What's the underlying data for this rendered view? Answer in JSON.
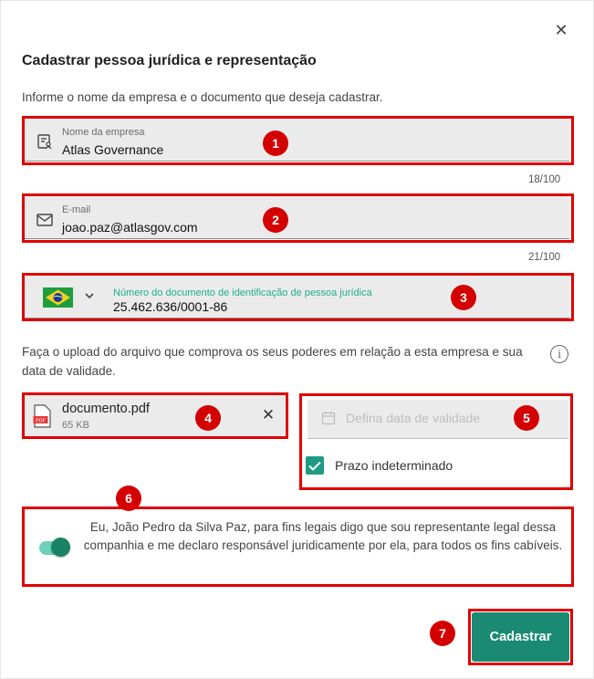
{
  "dialog": {
    "title": "Cadastrar pessoa jurídica e representação",
    "intro": "Informe o nome da empresa e o documento que deseja cadastrar.",
    "close_icon": "close-icon"
  },
  "company_field": {
    "label": "Nome da empresa",
    "value": "Atlas Governance",
    "counter": "18/100",
    "icon": "company-id-icon"
  },
  "email_field": {
    "label": "E-mail",
    "value": "joao.paz@atlasgov.com",
    "counter": "21/100",
    "icon": "envelope-icon"
  },
  "document_field": {
    "label": "Número do documento de identificação de pessoa jurídica",
    "value": "25.462.636/0001-86",
    "country_icon": "brazil-flag-icon"
  },
  "upload": {
    "text": "Faça o upload do arquivo que comprova os seus poderes em relação a esta empresa e sua data de validade.",
    "file_name": "documento.pdf",
    "file_size": "65 KB",
    "file_badge": "PDF"
  },
  "validity": {
    "placeholder": "Defina data de validade",
    "checkbox_label": "Prazo indeterminado",
    "checkbox_checked": true
  },
  "consent": {
    "text": "Eu, João Pedro da Silva Paz, para fins legais digo que sou representante legal dessa companhia e me declaro responsável juridicamente por ela, para todos os fins cabíveis.",
    "toggle_on": true
  },
  "actions": {
    "submit_label": "Cadastrar"
  },
  "annotations": [
    "1",
    "2",
    "3",
    "4",
    "5",
    "6",
    "7"
  ],
  "colors": {
    "accent": "#1a8a73",
    "highlight": "#e00000",
    "field_bg": "#ebebeb"
  }
}
